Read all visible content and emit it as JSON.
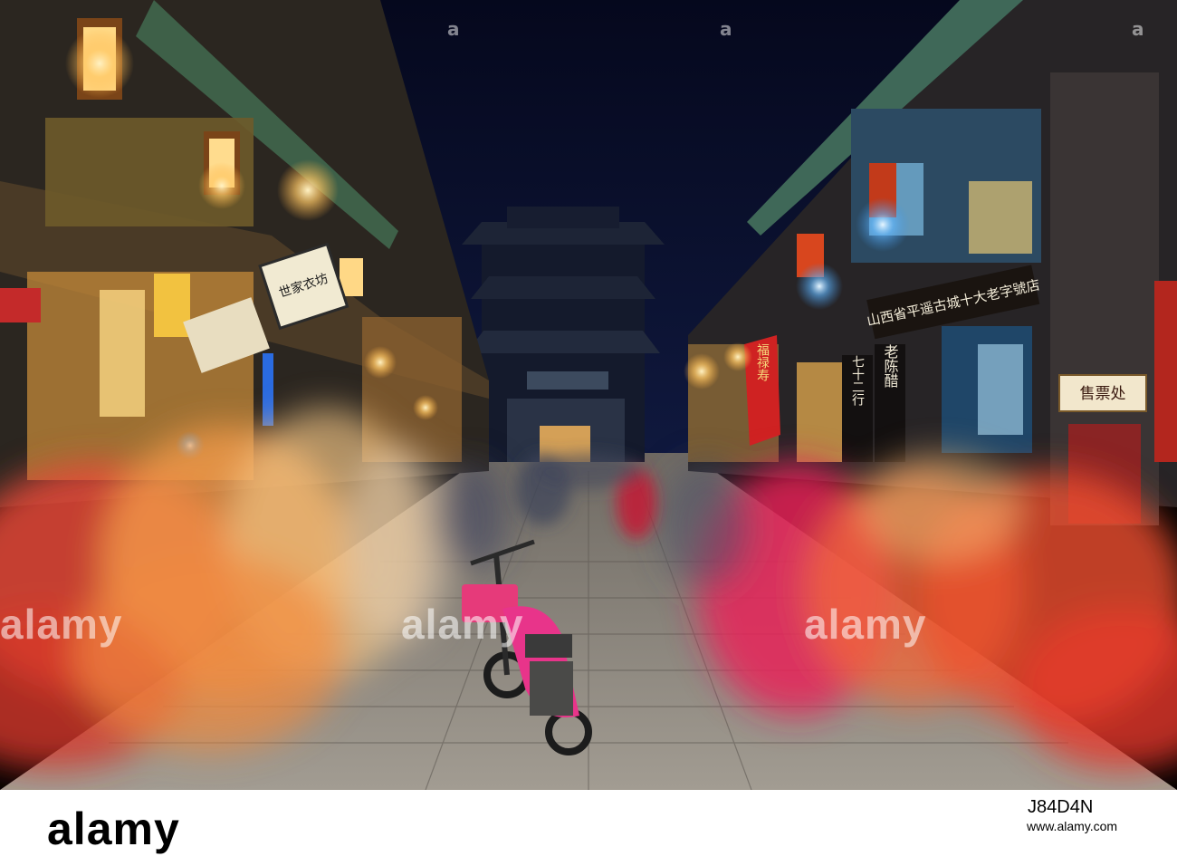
{
  "image": {
    "subject": "night-street",
    "palette": {
      "sky": "#0a0f2e",
      "warm_light": "#f7c774",
      "blur_red": "#e8364f",
      "blur_orange": "#f29a47",
      "cool_light": "#3b8fe0",
      "pavement": "#8a8a86"
    }
  },
  "signs": {
    "left_board_upper": "世家衣坊",
    "right_shop_long": "山西省平遥古城十大老字號店",
    "right_vertical_a": "老陈醋",
    "right_vertical_b": "七十二行",
    "ticket_sign": "售票处",
    "red_banner": "福禄寿"
  },
  "watermarks": {
    "middle": [
      "alamy",
      "alamy",
      "alamy"
    ],
    "top_row": [
      "a",
      "a",
      "a"
    ]
  },
  "credit": {
    "logo": "alamy",
    "id": "J84D4N",
    "url": "www.alamy.com"
  }
}
